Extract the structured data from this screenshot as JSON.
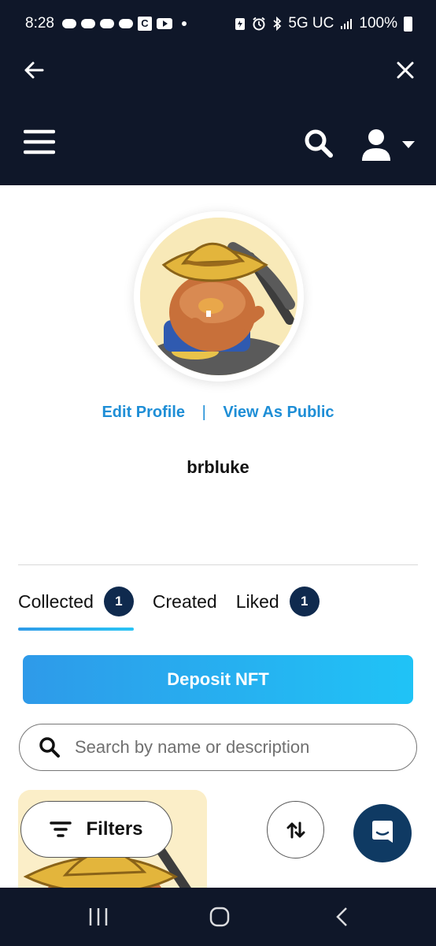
{
  "status_bar": {
    "time": "8:28",
    "network": "5G UC",
    "battery": "100%",
    "notification_icons": [
      "cloud-icon",
      "cloud-icon",
      "cloud-icon",
      "cloud-icon",
      "c-app-icon",
      "youtube-icon"
    ],
    "status_icons": [
      "battery-saver-icon",
      "alarm-icon",
      "bluetooth-icon",
      "signal-icon",
      "battery-icon"
    ]
  },
  "top_nav": {
    "icons": [
      "back-arrow-icon",
      "close-icon",
      "hamburger-menu-icon",
      "search-icon",
      "user-icon",
      "caret-down-icon"
    ]
  },
  "profile": {
    "edit_profile_label": "Edit Profile",
    "separator": "|",
    "view_as_public_label": "View As Public",
    "username": "brbluke"
  },
  "tabs": [
    {
      "label": "Collected",
      "count": "1",
      "active": true
    },
    {
      "label": "Created",
      "count": null,
      "active": false
    },
    {
      "label": "Liked",
      "count": "1",
      "active": false
    }
  ],
  "deposit_button_label": "Deposit NFT",
  "search": {
    "placeholder": "Search by name or description"
  },
  "filters_label": "Filters",
  "colors": {
    "header_bg": "#0f1729",
    "link_blue": "#1e8ed6",
    "badge_bg": "#0f2a4e",
    "deposit_gradient_start": "#2e9ae9",
    "deposit_gradient_end": "#20c3f6",
    "chat_bg": "#0f3a63"
  }
}
